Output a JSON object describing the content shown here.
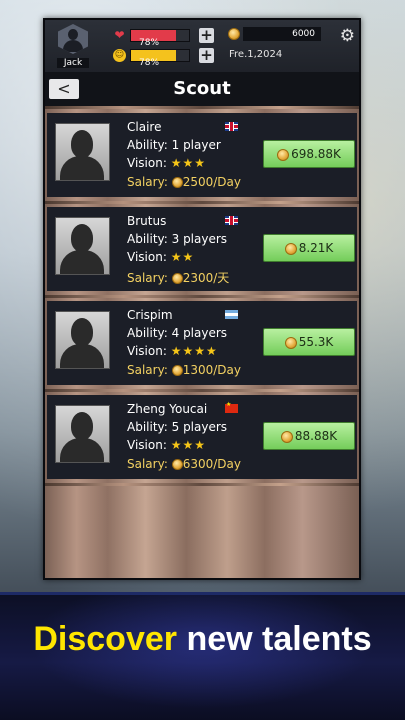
{
  "status": {
    "player_name": "Jack",
    "health_pct": "78%",
    "health_fill": 0.78,
    "mood_pct": "78%",
    "mood_fill": 0.78,
    "money": "6000",
    "date": "Fre.1,2024"
  },
  "header": {
    "title": "Scout",
    "back_label": "<"
  },
  "candidates": [
    {
      "name": "Claire",
      "flag": "uk",
      "ability": "Ability:  1 player",
      "vision_label": "Vision:",
      "stars": "★★★",
      "salary_label": "Salary:",
      "salary": "2500/Day",
      "price": "698.88K"
    },
    {
      "name": "Brutus",
      "flag": "uk",
      "ability": "Ability:  3 players",
      "vision_label": "Vision:",
      "stars": "★★",
      "salary_label": "Salary:",
      "salary": "2300/天",
      "price": "8.21K"
    },
    {
      "name": "Crispim",
      "flag": "ar",
      "ability": "Ability:  4 players",
      "vision_label": "Vision:",
      "stars": "★★★★",
      "salary_label": "Salary:",
      "salary": "1300/Day",
      "price": "55.3K"
    },
    {
      "name": "Zheng Youcai",
      "flag": "cn",
      "ability": "Ability:  5 players",
      "vision_label": "Vision:",
      "stars": "★★★",
      "salary_label": "Salary:",
      "salary": "6300/Day",
      "price": "88.88K"
    }
  ],
  "banner": {
    "part1": "Discover",
    "part2": "new talents"
  },
  "colors": {
    "health": "#e23b4a",
    "mood": "#f4c21d",
    "price_button": "#8edb73",
    "banner_accent": "#ffe600"
  }
}
